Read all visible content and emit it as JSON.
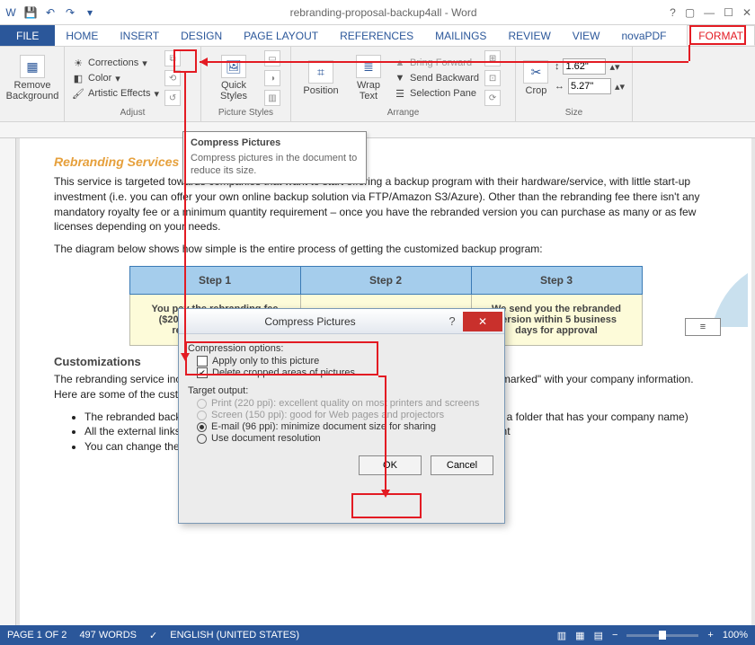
{
  "titlebar": {
    "title": "rebranding-proposal-backup4all - Word"
  },
  "tabs": {
    "file": "FILE",
    "home": "HOME",
    "insert": "INSERT",
    "design": "DESIGN",
    "pageLayout": "PAGE LAYOUT",
    "references": "REFERENCES",
    "mailings": "MAILINGS",
    "review": "REVIEW",
    "view": "VIEW",
    "novapdf": "novaPDF",
    "format": "FORMAT"
  },
  "ribbon": {
    "removeBg": "Remove Background",
    "corrections": "Corrections",
    "color": "Color",
    "artistic": "Artistic Effects",
    "adjust": "Adjust",
    "quickStyles": "Quick Styles",
    "pictureStyles": "Picture Styles",
    "position": "Position",
    "wrapText": "Wrap Text",
    "bringForward": "Bring Forward",
    "sendBackward": "Send Backward",
    "selectionPane": "Selection Pane",
    "arrange": "Arrange",
    "crop": "Crop",
    "height": "1.62\"",
    "width": "5.27\"",
    "size": "Size"
  },
  "tooltip": {
    "title": "Compress Pictures",
    "body": "Compress pictures in the document to reduce its size."
  },
  "doc": {
    "h1": "Rebranding Services",
    "p1": "This service is targeted towards companies that want to start offering a backup program with their hardware/service, with little start-up investment (i.e. you can offer your own online backup solution via FTP/Amazon S3/Azure). Other than the rebranding fee there isn't any mandatory royalty fee or a minimum quantity requirement – once you have the rebranded version you can purchase as many or as few licenses depending on your needs.",
    "p2": "The diagram below shows how simple is the entire process of getting the customized backup program:",
    "steps": {
      "s1": "Step 1",
      "s2": "Step 2",
      "s3": "Step 3"
    },
    "cells": {
      "c1": "You pay the rebranding fee ($2000) and send us the rebranding details",
      "c2": "",
      "c3": "We send you the rebranded version within 5 business days for approval"
    },
    "h2": "Customizations",
    "p3": "The rebranding service includes compiling a backup program with the name you choose and \"marked\" with your company information. Here are some of the customizations that you can opt for:",
    "li1": "The rebranded backup program will have a name chosen by you (and will be installed in a folder that has your company name)",
    "li2": "All the external links (emails, buy/register/read more) will point to whatever links you want",
    "li3": "You can change the installer logo/name and the splash installer"
  },
  "dialog": {
    "title": "Compress Pictures",
    "compOptions": "Compression options:",
    "applyOnly": "Apply only to this picture",
    "deleteCropped": "Delete cropped areas of pictures",
    "targetOutput": "Target output:",
    "print": "Print (220 ppi): excellent quality on most printers and screens",
    "screen": "Screen (150 ppi): good for Web pages and projectors",
    "email": "E-mail (96 ppi): minimize document size for sharing",
    "docRes": "Use document resolution",
    "ok": "OK",
    "cancel": "Cancel"
  },
  "status": {
    "page": "PAGE 1 OF 2",
    "words": "497 WORDS",
    "lang": "ENGLISH (UNITED STATES)",
    "zoom": "100%"
  }
}
